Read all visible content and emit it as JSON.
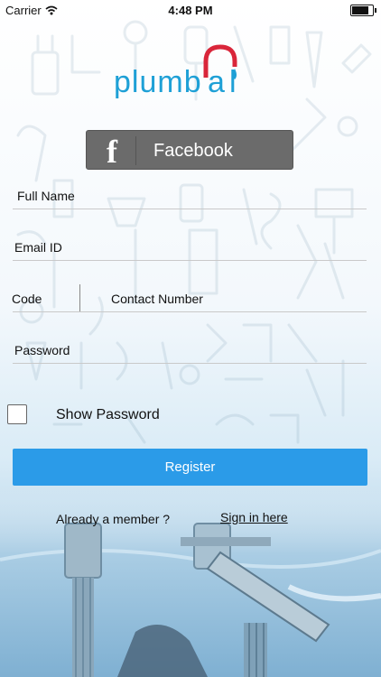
{
  "status_bar": {
    "carrier": "Carrier",
    "time": "4:48 PM",
    "battery_level": 0.92
  },
  "logo": {
    "text": "plumbal",
    "accent_color": "#d9263a",
    "primary_color": "#1ea0d6"
  },
  "facebook_button": {
    "icon": "facebook-f-icon",
    "label": "Facebook"
  },
  "form": {
    "full_name": {
      "placeholder": "Full Name"
    },
    "email": {
      "placeholder": "Email ID"
    },
    "code": {
      "placeholder": "Code"
    },
    "contact_number": {
      "placeholder": "Contact Number"
    },
    "password": {
      "placeholder": "Password"
    },
    "show_password": {
      "label": "Show Password",
      "checked": false
    }
  },
  "register_button": {
    "label": "Register",
    "color": "#2b9be8"
  },
  "footer": {
    "member_text": "Already a member ?",
    "signin_link": "Sign in here"
  }
}
